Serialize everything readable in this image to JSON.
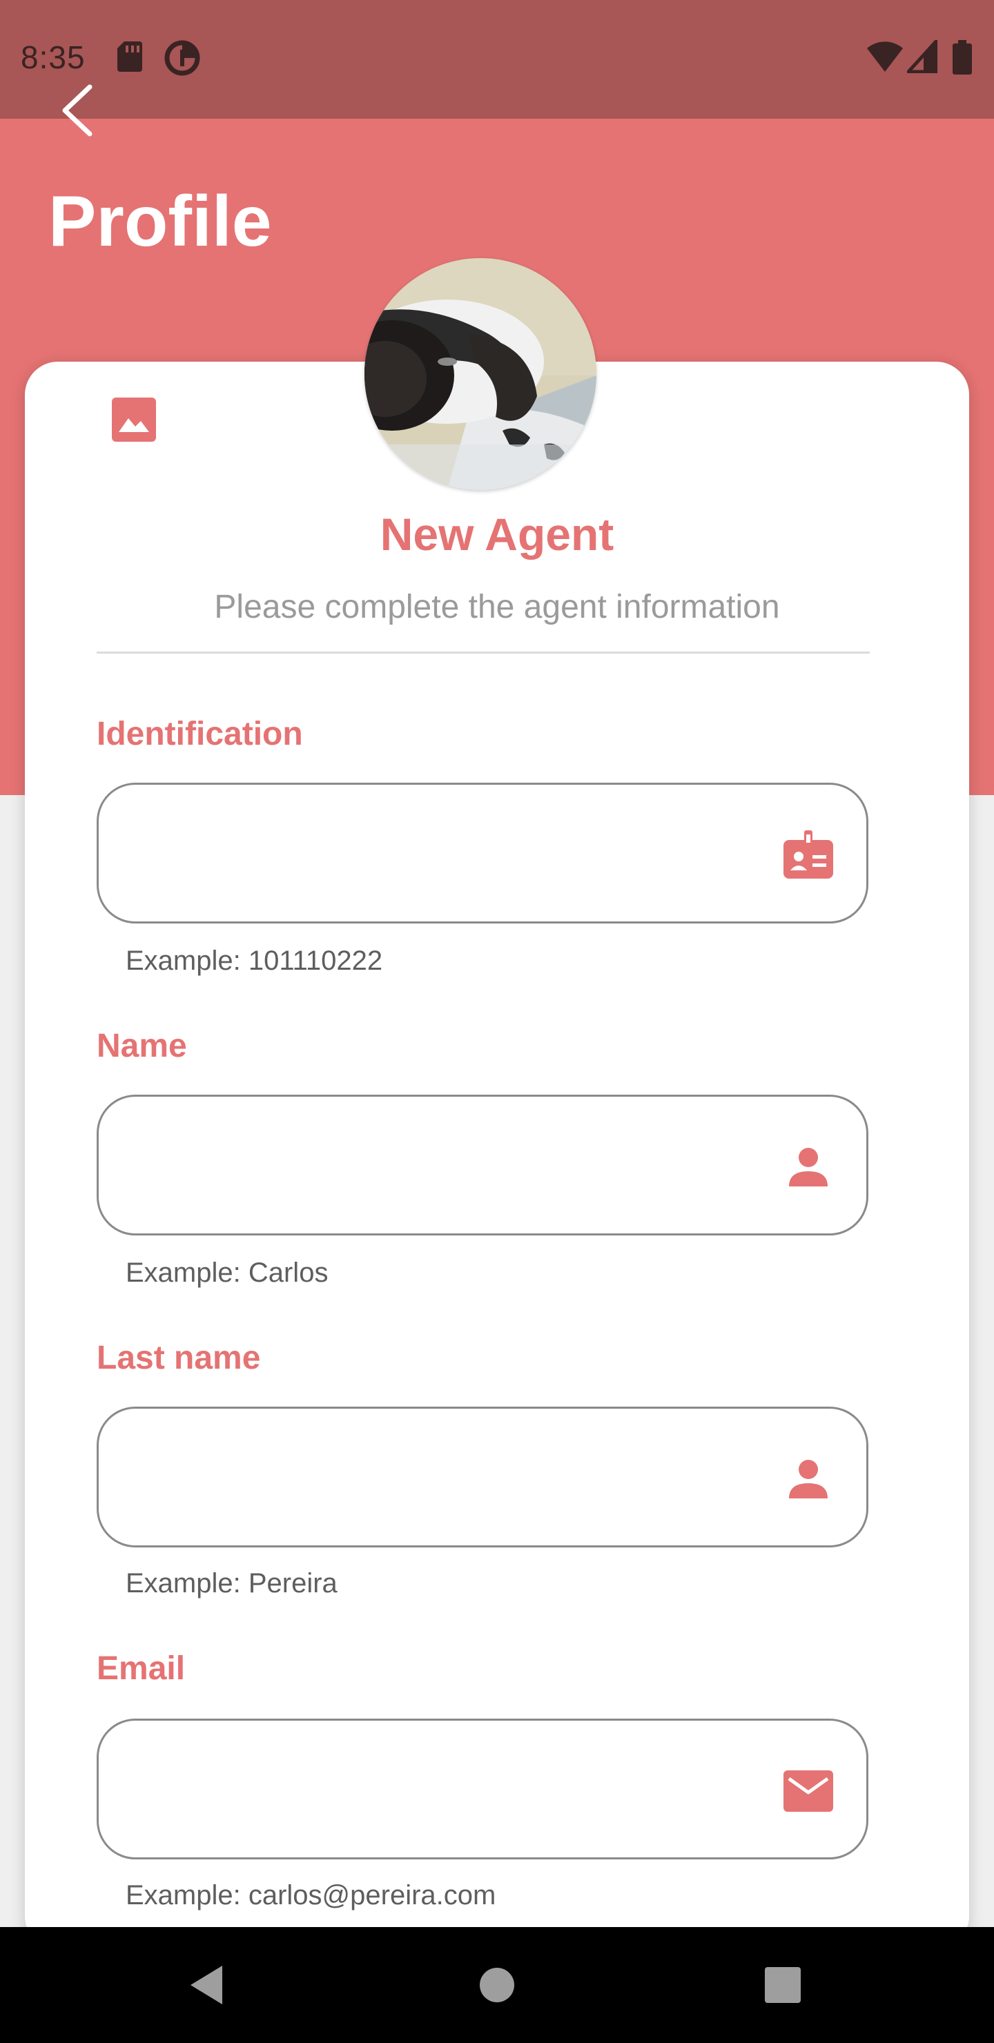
{
  "status_bar": {
    "time": "8:35",
    "left_icons": [
      "sd-card-icon",
      "data-saver-icon"
    ],
    "right_icons": [
      "wifi-icon",
      "signal-icon",
      "battery-icon"
    ]
  },
  "header": {
    "title": "Profile",
    "back_icon": "chevron-left-icon",
    "background_color": "#e57373"
  },
  "profile": {
    "avatar": "dog-photo",
    "change_image_icon": "image-icon",
    "title": "New Agent",
    "subtitle": "Please complete the agent information"
  },
  "form": {
    "fields": [
      {
        "label": "Identification",
        "value": "",
        "helper": "Example: 101110222",
        "icon": "id-badge-icon"
      },
      {
        "label": "Name",
        "value": "",
        "helper": "Example: Carlos",
        "icon": "person-icon"
      },
      {
        "label": "Last name",
        "value": "",
        "helper": "Example: Pereira",
        "icon": "person-icon"
      },
      {
        "label": "Email",
        "value": "",
        "helper": "Example: carlos@pereira.com",
        "icon": "mail-icon"
      }
    ]
  },
  "nav_bar": {
    "buttons": [
      "back-triangle-icon",
      "home-circle-icon",
      "recents-square-icon"
    ]
  },
  "colors": {
    "accent": "#e57373",
    "status_bar": "#a85656",
    "helper_text": "#5e5e5e",
    "subtitle_text": "#9a9a9a"
  }
}
